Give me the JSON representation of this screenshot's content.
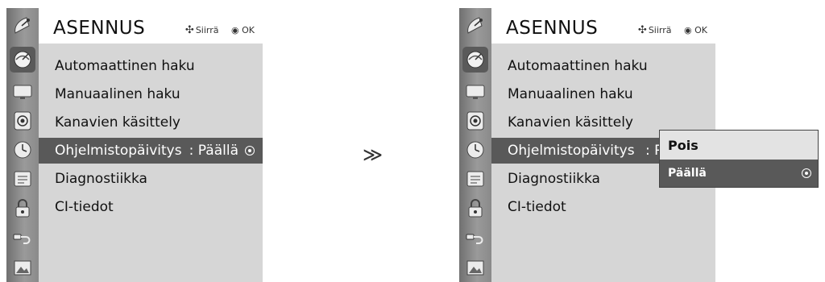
{
  "panels": [
    {
      "title": "ASENNUS",
      "hints": {
        "move_label": "Siirrä",
        "ok_label": "OK"
      },
      "items": [
        {
          "label": "Automaattinen haku"
        },
        {
          "label": "Manuaalinen haku"
        },
        {
          "label": "Kanavien käsittely"
        },
        {
          "label": "Ohjelmistopäivitys",
          "value": ": Päällä"
        },
        {
          "label": "Diagnostiikka"
        },
        {
          "label": "CI-tiedot"
        }
      ]
    },
    {
      "title": "ASENNUS",
      "hints": {
        "move_label": "Siirrä",
        "ok_label": "OK"
      },
      "items": [
        {
          "label": "Automaattinen haku"
        },
        {
          "label": "Manuaalinen haku"
        },
        {
          "label": "Kanavien käsittely"
        },
        {
          "label": "Ohjelmistopäivitys",
          "value": ": P"
        },
        {
          "label": "Diagnostiikka"
        },
        {
          "label": "CI-tiedot"
        }
      ]
    }
  ],
  "sidebar_icons": [
    "setup-satellite-icon",
    "picture-icon",
    "audio-icon",
    "time-icon",
    "option-icon",
    "lock-icon",
    "input-icon",
    "media-icon"
  ],
  "step_arrow": "≫",
  "popup": {
    "options": [
      {
        "label": "Pois",
        "selected": false
      },
      {
        "label": "Päällä",
        "selected": true
      }
    ]
  },
  "colors": {
    "sidebar": "#8a8a8a",
    "menu_background": "#d6d6d6",
    "selection": "#595959",
    "popup_background": "#e3e3e3"
  }
}
